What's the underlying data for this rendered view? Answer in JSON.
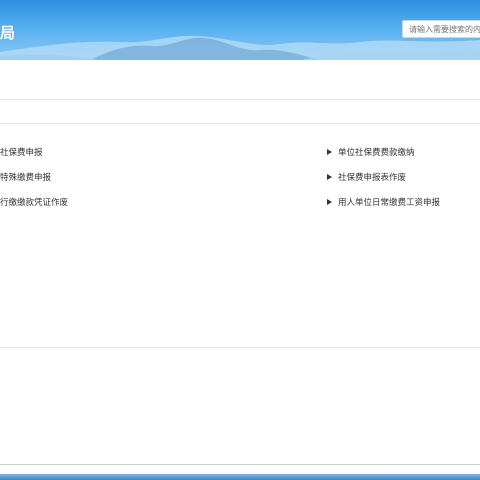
{
  "header": {
    "title": "局",
    "search_placeholder": "请输入需要搜索的内容"
  },
  "links": {
    "left": [
      "社保费申报",
      "特殊缴费申报",
      "行缴缴款凭证作废"
    ],
    "right": [
      "单位社保费费款缴纳",
      "社保费申报表作废",
      "用人单位日常缴费工资申报"
    ]
  },
  "colors": {
    "header_top": "#2f8ee0",
    "header_bottom": "#8ccaf6",
    "text": "#333333"
  }
}
